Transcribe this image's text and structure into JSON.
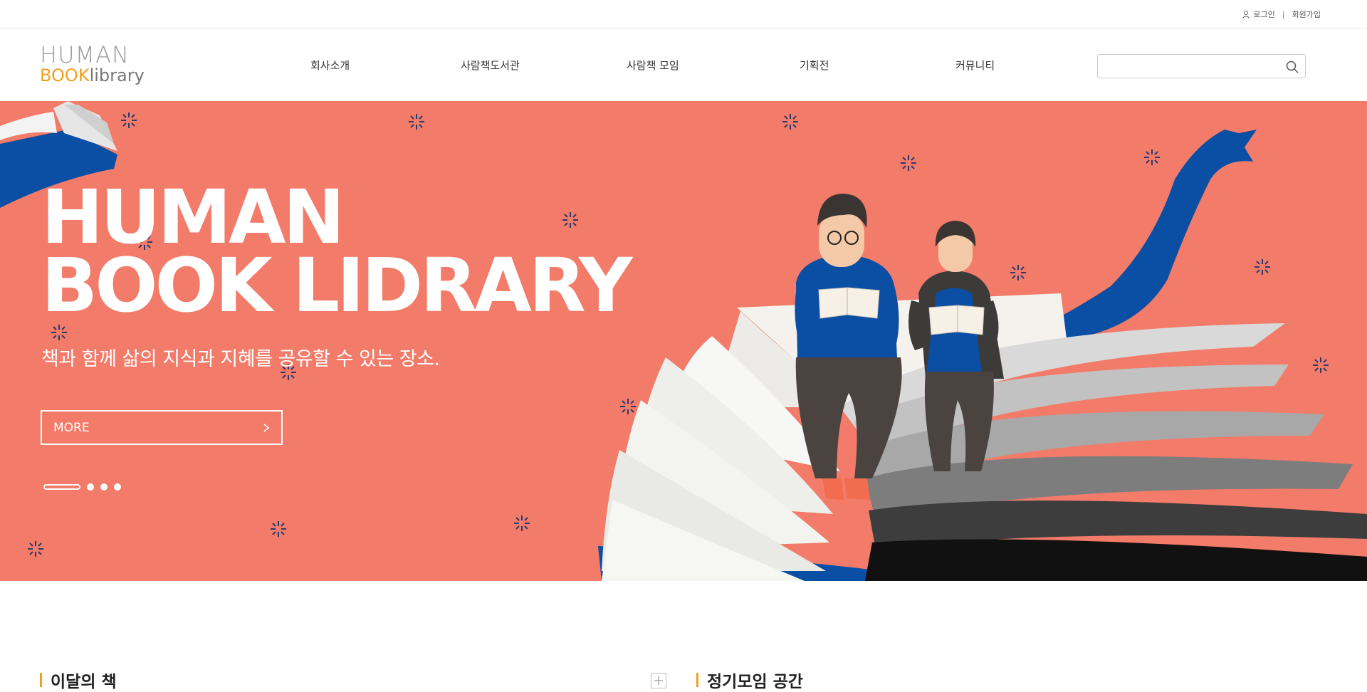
{
  "topbar": {
    "login": "로그인",
    "separator": "|",
    "signup": "회원가입"
  },
  "logo": {
    "line1": "HUMAN",
    "book": "BOOK",
    "library": "library"
  },
  "nav": [
    {
      "label": "회사소개"
    },
    {
      "label": "사람책도서관"
    },
    {
      "label": "사람책 모임"
    },
    {
      "label": "기획전"
    },
    {
      "label": "커뮤니티"
    }
  ],
  "search": {
    "value": "",
    "placeholder": ""
  },
  "hero": {
    "title_line1": "HUMAN",
    "title_line2": "BOOK LIDRARY",
    "subtitle": "책과 함께 삶의 지식과 지혜를 공유할 수 있는 장소.",
    "more_label": "MORE",
    "slides_total": 4,
    "active_slide": 1,
    "background_color": "#f37b69"
  },
  "sections": {
    "book_of_month": "이달의 책",
    "meeting_space": "정기모임 공간"
  },
  "colors": {
    "accent": "#f0a01e",
    "hero": "#f37b69",
    "navy": "#2b3a6b",
    "blue": "#0a4fa3"
  }
}
